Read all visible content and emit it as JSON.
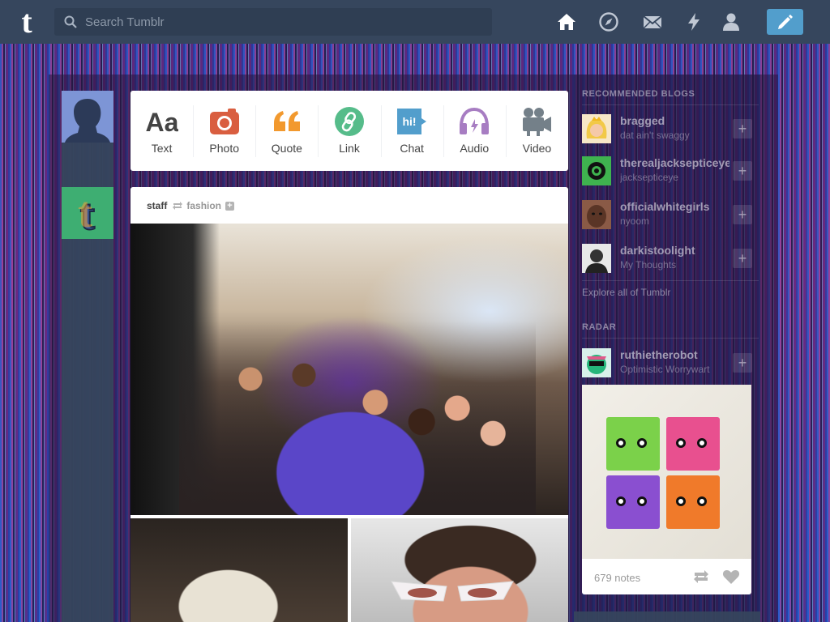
{
  "topbar": {
    "logo": "t",
    "search_placeholder": "Search Tumblr",
    "icons": [
      "home-icon",
      "explore-compass-icon",
      "inbox-mail-icon",
      "activity-lightning-icon",
      "account-person-icon",
      "compose-pencil-icon"
    ]
  },
  "post_types": [
    {
      "label": "Text",
      "icon": "text-icon",
      "color": "#444444"
    },
    {
      "label": "Photo",
      "icon": "camera-icon",
      "color": "#d95e40"
    },
    {
      "label": "Quote",
      "icon": "quote-icon",
      "color": "#f2992e"
    },
    {
      "label": "Link",
      "icon": "link-icon",
      "color": "#56bc8a"
    },
    {
      "label": "Chat",
      "icon": "chat-icon",
      "color": "#529ecc"
    },
    {
      "label": "Audio",
      "icon": "headphones-icon",
      "color": "#a77dc2"
    },
    {
      "label": "Video",
      "icon": "video-camera-icon",
      "color": "#748089"
    }
  ],
  "post": {
    "author": "staff",
    "source": "fashion"
  },
  "sidebar": {
    "recommended_heading": "Recommended Blogs",
    "blogs": [
      {
        "name": "bragged",
        "subtitle": "dat ain't swaggy"
      },
      {
        "name": "therealjacksepticeye",
        "subtitle": "jacksepticeye"
      },
      {
        "name": "officialwhitegirls",
        "subtitle": "nyoom"
      },
      {
        "name": "darkistoolight",
        "subtitle": "My Thoughts"
      }
    ],
    "explore_link": "Explore all of Tumblr",
    "radar_heading": "Radar",
    "radar": {
      "name": "ruthietherobot",
      "subtitle": "Optimistic Worrywart",
      "notes": "679 notes"
    }
  },
  "colors": {
    "topbar": "#36465d",
    "accent": "#529ecc"
  }
}
